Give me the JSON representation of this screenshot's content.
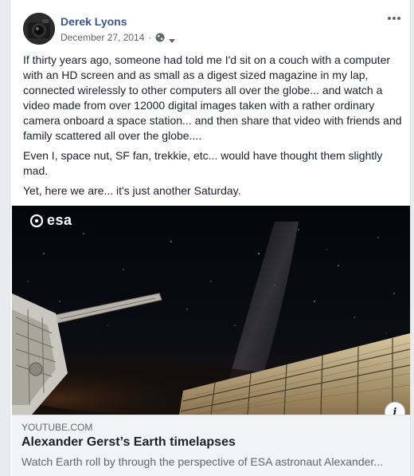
{
  "post": {
    "author": "Derek Lyons",
    "date": "December 27, 2014",
    "separator": "·",
    "privacy_icon": "globe-icon",
    "paragraphs": [
      "If thirty years ago, someone had told me I'd sit on a couch with a computer with an HD screen and as small as a digest sized magazine in my lap, connected wirelessly to other computers all over the globe... and watch a video made from over 12000 digital images taken with a rather ordinary camera onboard a space station... and then share that video with friends and family scattered all over the globe....",
      "Even I, space nut, SF fan, trekkie, etc... would have thought them slightly mad.",
      "Yet, here we are... it's just another Saturday."
    ]
  },
  "media": {
    "logo_text": "esa",
    "info_label": "i"
  },
  "link": {
    "domain": "YOUTUBE.COM",
    "title": "Alexander Gerst’s Earth timelapses",
    "description": "Watch Earth roll by through the perspective of ESA astronaut Alexander..."
  },
  "colors": {
    "author": "#385898",
    "meta": "#616770",
    "text": "#1d2129",
    "preview_bg": "#f2f3f5"
  }
}
